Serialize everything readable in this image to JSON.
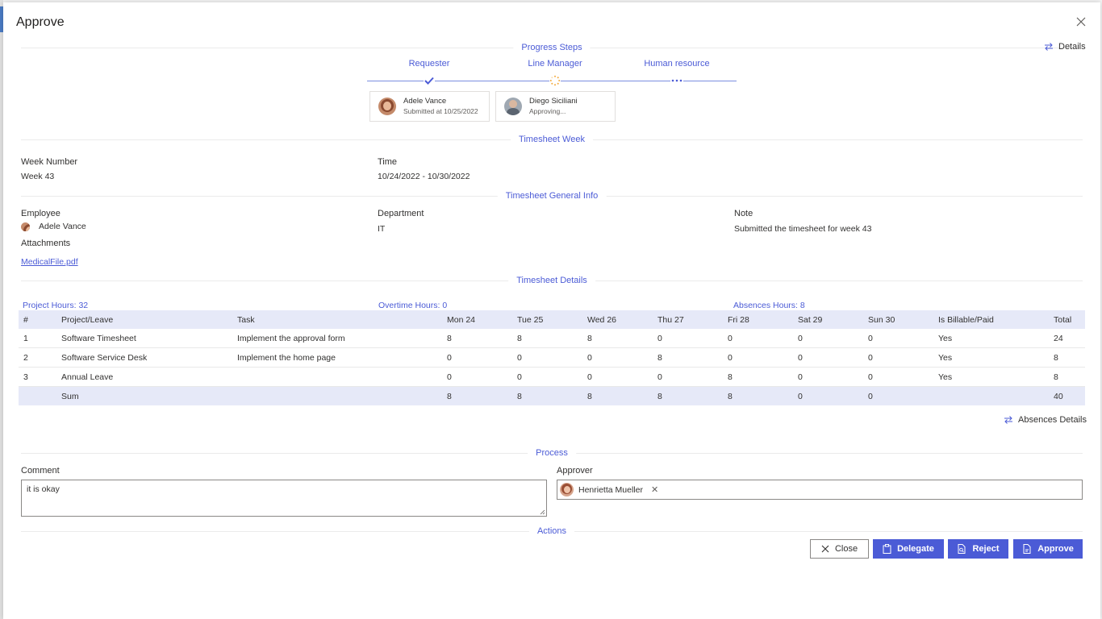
{
  "dialog": {
    "title": "Approve"
  },
  "details_label": "Details",
  "progress": {
    "title": "Progress Steps",
    "steps": [
      {
        "label": "Requester",
        "state": "completed"
      },
      {
        "label": "Line Manager",
        "state": "in-progress"
      },
      {
        "label": "Human resource",
        "state": "pending"
      }
    ],
    "cards": [
      {
        "name": "Adele Vance",
        "status": "Submitted at 10/25/2022"
      },
      {
        "name": "Diego Siciliani",
        "status": "Approving..."
      }
    ]
  },
  "timesheet_week": {
    "title": "Timesheet Week",
    "week_number_label": "Week Number",
    "week_number": "Week 43",
    "time_label": "Time",
    "time": "10/24/2022 - 10/30/2022"
  },
  "general_info": {
    "title": "Timesheet General Info",
    "employee_label": "Employee",
    "employee": "Adele Vance",
    "department_label": "Department",
    "department": "IT",
    "note_label": "Note",
    "note": "Submitted the timesheet for week 43",
    "attachments_label": "Attachments",
    "attachment": "MedicalFile.pdf"
  },
  "details": {
    "title": "Timesheet Details",
    "project_hours": "Project Hours: 32",
    "overtime_hours": "Overtime Hours: 0",
    "absences_hours": "Absences Hours: 8",
    "columns": [
      "#",
      "Project/Leave",
      "Task",
      "Mon 24",
      "Tue 25",
      "Wed 26",
      "Thu 27",
      "Fri 28",
      "Sat 29",
      "Sun 30",
      "Is Billable/Paid",
      "Total"
    ],
    "rows": [
      [
        "1",
        "Software Timesheet",
        "Implement the approval form",
        "8",
        "8",
        "8",
        "0",
        "0",
        "0",
        "0",
        "Yes",
        "24"
      ],
      [
        "2",
        "Software Service Desk",
        "Implement the home page",
        "0",
        "0",
        "0",
        "8",
        "0",
        "0",
        "0",
        "Yes",
        "8"
      ],
      [
        "3",
        "Annual Leave",
        "",
        "0",
        "0",
        "0",
        "0",
        "8",
        "0",
        "0",
        "Yes",
        "8"
      ]
    ],
    "sum_row": [
      "",
      "Sum",
      "",
      "8",
      "8",
      "8",
      "8",
      "8",
      "0",
      "0",
      "",
      "40"
    ],
    "absences_details_label": "Absences Details"
  },
  "process": {
    "title": "Process",
    "comment_label": "Comment",
    "comment_value": "it is okay",
    "approver_label": "Approver",
    "approver": "Henrietta Mueller"
  },
  "actions": {
    "title": "Actions",
    "close": "Close",
    "delegate": "Delegate",
    "reject": "Reject",
    "approve": "Approve"
  },
  "colors": {
    "accent": "#4b5bd6",
    "header_bg": "#e6e9f8",
    "progress_orange": "#f3a93b"
  }
}
